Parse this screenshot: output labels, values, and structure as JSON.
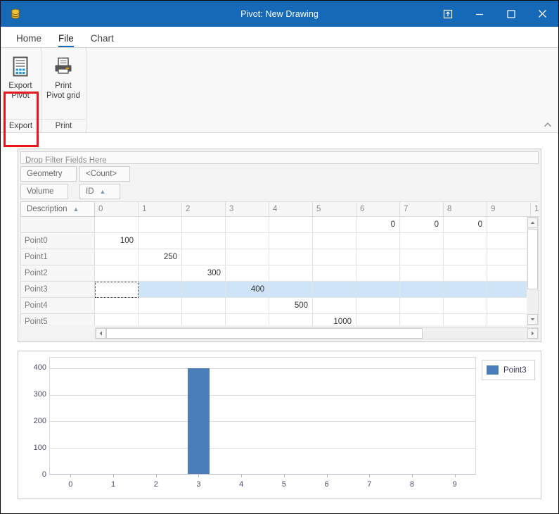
{
  "window": {
    "title": "Pivot: New Drawing",
    "app_icon": "database-icon",
    "controls": {
      "dock": "dock-window-icon",
      "minimize": "minimize-icon",
      "maximize": "maximize-icon",
      "close": "close-icon"
    }
  },
  "tabs": [
    {
      "label": "Home",
      "active": false
    },
    {
      "label": "File",
      "active": true
    },
    {
      "label": "Chart",
      "active": false
    }
  ],
  "ribbon": {
    "collapse_icon": "chevron-up-icon",
    "groups": [
      {
        "label": "Export",
        "buttons": [
          {
            "label_line1": "Export",
            "label_line2": "Pivot",
            "icon": "export-pivot-icon",
            "highlighted": true
          }
        ]
      },
      {
        "label": "Print",
        "buttons": [
          {
            "label_line1": "Print",
            "label_line2": "Pivot grid",
            "icon": "printer-icon",
            "highlighted": false
          }
        ]
      }
    ],
    "highlight_color": "#e8161a"
  },
  "pivot": {
    "filter_area_text": "Drop Filter Fields Here",
    "row_fields": [
      {
        "label": "Geometry",
        "sort": ""
      },
      {
        "label": "Volume",
        "sort": ""
      }
    ],
    "data_fields": [
      {
        "label": "<Count>",
        "sort": ""
      },
      {
        "label": "ID",
        "sort": "▲"
      }
    ],
    "corner_field": {
      "label": "Description",
      "sort": "▲"
    },
    "column_headers": [
      "0",
      "1",
      "2",
      "3",
      "4",
      "5",
      "6",
      "7",
      "8",
      "9"
    ],
    "rows": [
      {
        "header": "",
        "cells": [
          "",
          "",
          "",
          "",
          "",
          "",
          "0",
          "0",
          "0",
          ""
        ],
        "selected": false
      },
      {
        "header": "Point0",
        "cells": [
          "100",
          "",
          "",
          "",
          "",
          "",
          "",
          "",
          "",
          ""
        ],
        "selected": false
      },
      {
        "header": "Point1",
        "cells": [
          "",
          "250",
          "",
          "",
          "",
          "",
          "",
          "",
          "",
          ""
        ],
        "selected": false
      },
      {
        "header": "Point2",
        "cells": [
          "",
          "",
          "300",
          "",
          "",
          "",
          "",
          "",
          "",
          ""
        ],
        "selected": false
      },
      {
        "header": "Point3",
        "cells": [
          "",
          "",
          "",
          "400",
          "",
          "",
          "",
          "",
          "",
          ""
        ],
        "selected": true,
        "focused_cell": 0
      },
      {
        "header": "Point4",
        "cells": [
          "",
          "",
          "",
          "",
          "500",
          "",
          "",
          "",
          "",
          ""
        ],
        "selected": false
      },
      {
        "header": "Point5",
        "cells": [
          "",
          "",
          "",
          "",
          "",
          "1000",
          "",
          "",
          "",
          ""
        ],
        "selected": false
      }
    ],
    "selection_color": "#cfe4f7",
    "v_scroll": {
      "up": "scroll-up-icon",
      "down": "scroll-down-icon"
    },
    "h_scroll": {
      "left": "scroll-left-icon",
      "right": "scroll-right-icon"
    }
  },
  "chart_data": {
    "type": "bar",
    "title": "",
    "xlabel": "",
    "ylabel": "",
    "categories": [
      "0",
      "1",
      "2",
      "3",
      "4",
      "5",
      "6",
      "7",
      "8",
      "9"
    ],
    "x": [
      0,
      1,
      2,
      3,
      4,
      5,
      6,
      7,
      8,
      9
    ],
    "series": [
      {
        "name": "Point3",
        "color": "#4a7ebb",
        "values": [
          0,
          0,
          0,
          400,
          0,
          0,
          0,
          0,
          0,
          0
        ]
      }
    ],
    "yticks": [
      0,
      100,
      200,
      300,
      400
    ],
    "ylim": [
      0,
      440
    ],
    "xlim": [
      -0.5,
      9.5
    ],
    "grid": true,
    "legend_position": "right",
    "legend": [
      "Point3"
    ]
  }
}
